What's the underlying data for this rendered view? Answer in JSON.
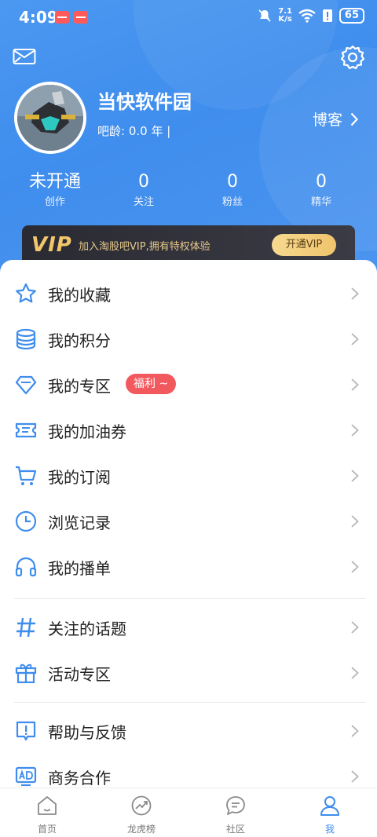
{
  "status_bar": {
    "time": "4:09",
    "net_speed_top": "7.1",
    "net_speed_bottom": "K/s",
    "battery": "65"
  },
  "profile": {
    "name": "当快软件园",
    "age_label": "吧龄: 0.0 年 |",
    "blog_label": "博客"
  },
  "stats": [
    {
      "value": "未开通",
      "label": "创作"
    },
    {
      "value": "0",
      "label": "关注"
    },
    {
      "value": "0",
      "label": "粉丝"
    },
    {
      "value": "0",
      "label": "精华"
    }
  ],
  "vip": {
    "logo": "VIP",
    "text": "加入淘股吧VIP,拥有特权体验",
    "button": "开通VIP"
  },
  "menu": [
    {
      "label": "我的收藏",
      "icon": "star-icon"
    },
    {
      "label": "我的积分",
      "icon": "coins-icon"
    },
    {
      "label": "我的专区",
      "icon": "diamond-icon",
      "badge": "福利 ~"
    },
    {
      "label": "我的加油券",
      "icon": "ticket-icon"
    },
    {
      "label": "我的订阅",
      "icon": "cart-icon"
    },
    {
      "label": "浏览记录",
      "icon": "clock-icon"
    },
    {
      "label": "我的播单",
      "icon": "headphones-icon"
    },
    {
      "label": "关注的话题",
      "icon": "hash-icon"
    },
    {
      "label": "活动专区",
      "icon": "gift-icon"
    },
    {
      "label": "帮助与反馈",
      "icon": "feedback-icon"
    },
    {
      "label": "商务合作",
      "icon": "ad-icon"
    }
  ],
  "tabs": [
    {
      "label": "首页",
      "icon": "home-icon"
    },
    {
      "label": "龙虎榜",
      "icon": "trend-icon"
    },
    {
      "label": "社区",
      "icon": "chat-icon"
    },
    {
      "label": "我",
      "icon": "user-icon",
      "active": true
    }
  ],
  "colors": {
    "accent": "#3f8ded",
    "badge": "#f2595f",
    "vip_gold": "#f0c46c"
  }
}
